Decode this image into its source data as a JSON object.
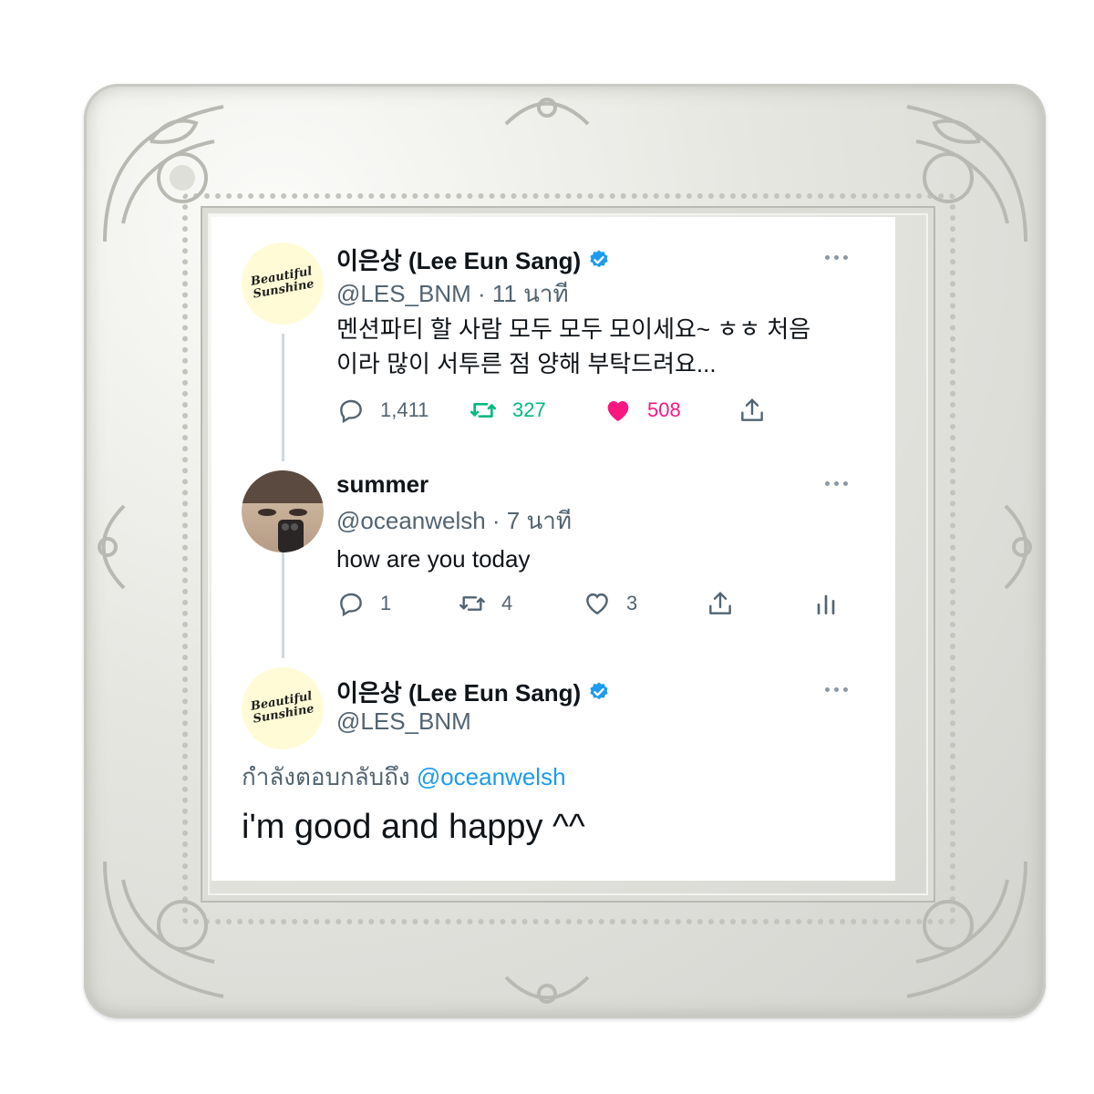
{
  "colors": {
    "accent": "#1d9bf0",
    "retweet_active": "#00ba7c",
    "like_active": "#f91880",
    "secondary_text": "#536471"
  },
  "tweet1": {
    "avatar_text": [
      "Beautiful",
      "Sunshine"
    ],
    "display_name": "이은상 (Lee Eun Sang)",
    "verified": true,
    "handle": "@LES_BNM · 11 นาที",
    "text_line1": "멘션파티 할 사람 모두 모두 모이세요~ ㅎㅎ 처음",
    "text_line2": "이라 많이 서투른 점 양해 부탁드려요...",
    "replies": "1,411",
    "retweets": "327",
    "likes": "508",
    "retweeted": true,
    "liked": true
  },
  "tweet2": {
    "avatar": "selfie-photo",
    "display_name": "summer",
    "handle": "@oceanwelsh · 7 นาที",
    "text": "how are you today",
    "replies": "1",
    "retweets": "4",
    "likes": "3"
  },
  "tweet3": {
    "avatar_text": [
      "Beautiful",
      "Sunshine"
    ],
    "display_name": "이은상 (Lee Eun Sang)",
    "verified": true,
    "handle": "@LES_BNM",
    "replying_to_label": "กำลังตอบกลับถึง",
    "replying_to_handle": "@oceanwelsh",
    "text": "i'm good and happy ^^"
  },
  "icons": [
    "reply-icon",
    "retweet-icon",
    "like-icon",
    "share-icon",
    "analytics-icon",
    "more-icon",
    "verified-badge-icon"
  ]
}
